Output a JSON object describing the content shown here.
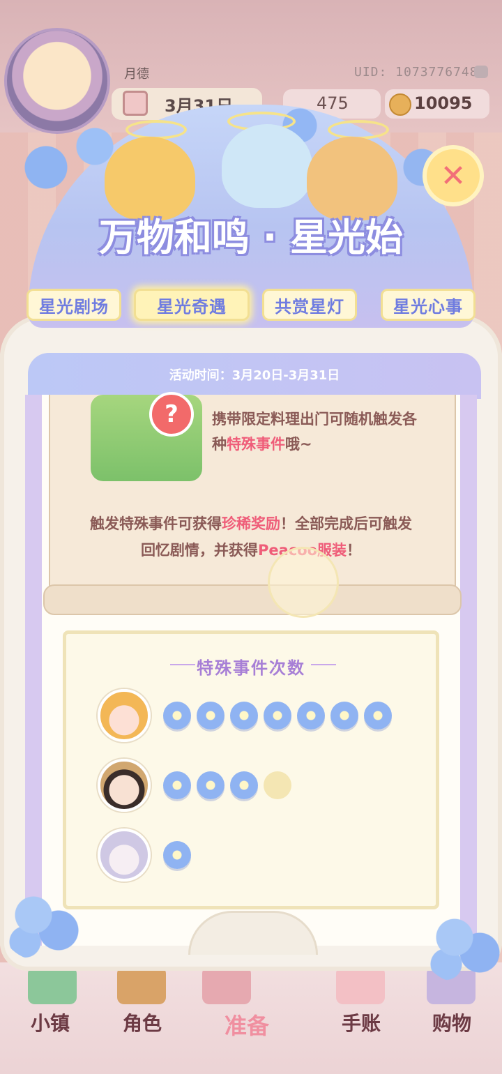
{
  "player": {
    "name": "月德",
    "uid": "UID: 1073776748",
    "date": "3月31日"
  },
  "currency": {
    "gems": "475",
    "coins": "10095"
  },
  "event": {
    "title": "万物和鸣 · 星光始",
    "tabs": [
      "星光剧场",
      "星光奇遇",
      "共赏星灯",
      "星光心事"
    ],
    "active_tab": "星光奇遇",
    "time": "活动时间：3月20日-3月31日"
  },
  "info": {
    "line1_a": "携带限定料理出门可随机触",
    "line1_b": "发各种",
    "line1_hl": "特殊事件",
    "line1_c": "哦~",
    "line2_a": "触发特殊事件可获得",
    "line2_hl1": "珍稀奖励",
    "line2_b": "！全部完成后可触发回忆剧情，并获得",
    "line2_hl2": "Peacoo服装",
    "line2_c": "！"
  },
  "counts": {
    "title": "特殊事件次数",
    "rows": [
      {
        "filled": 7,
        "total": 7
      },
      {
        "filled": 3,
        "total": 4
      },
      {
        "filled": 1,
        "total": 1
      }
    ]
  },
  "bottom_nav": [
    "小镇",
    "角色",
    "准备",
    "手账",
    "购物"
  ],
  "colors": {
    "accent_blue": "#6f7ce0",
    "highlight": "#ef5d79",
    "purple": "#a77fd6"
  },
  "icons": {
    "close": "close-icon",
    "question": "question-icon",
    "flower": "flower-icon"
  }
}
